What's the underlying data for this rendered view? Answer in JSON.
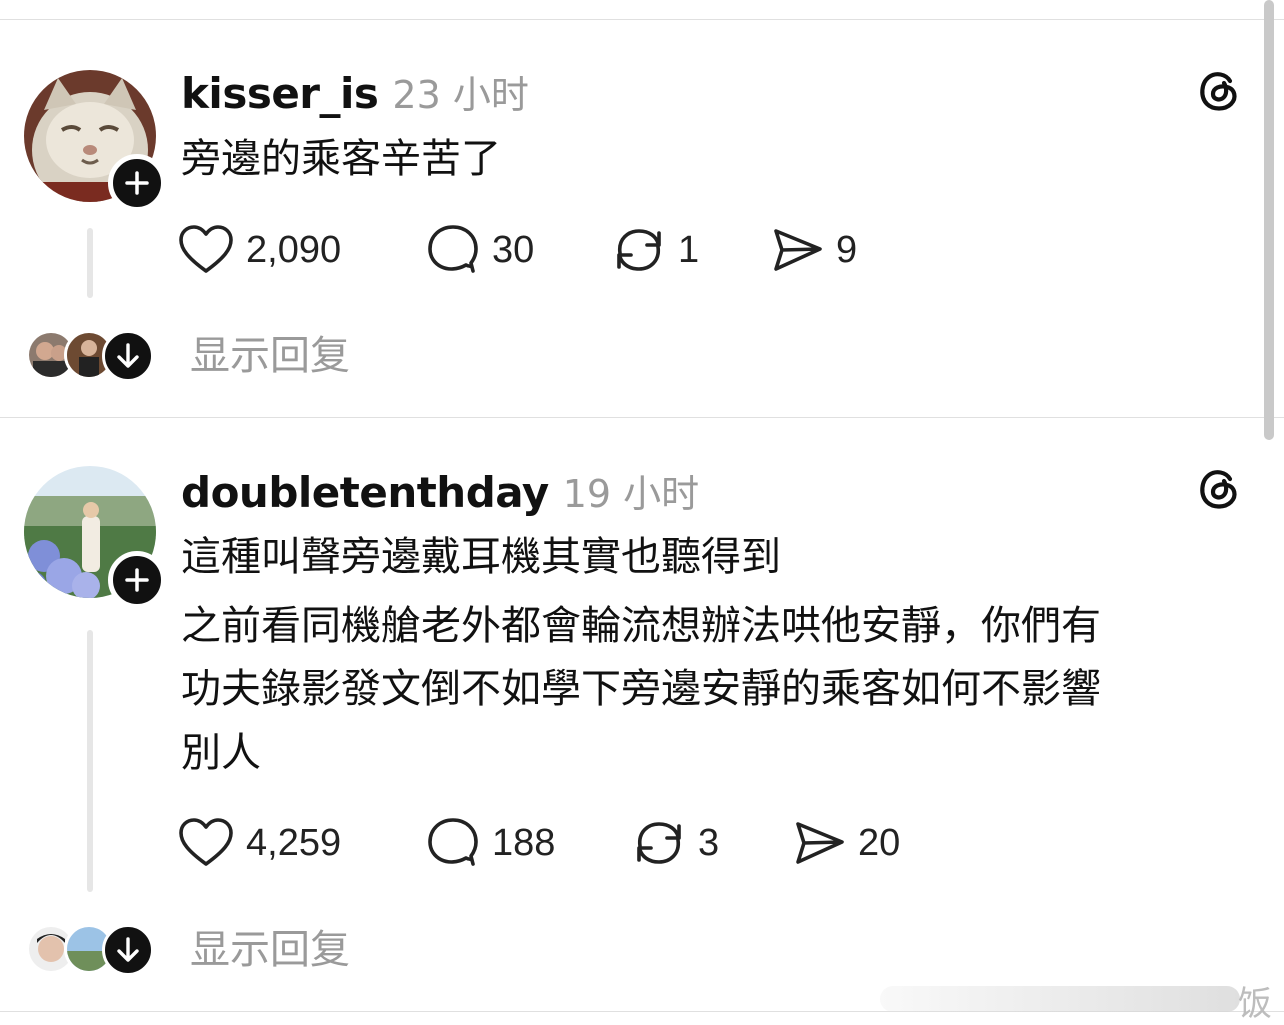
{
  "posts": [
    {
      "username": "kisser_is",
      "time": "23 小时",
      "text_lines": [
        "旁邊的乘客辛苦了"
      ],
      "likes": "2,090",
      "comments": "30",
      "reposts": "1",
      "shares": "9",
      "show_replies": "显示回复",
      "avatar_desc": "white-cat-avatar"
    },
    {
      "username": "doubletenthday",
      "time": "19 小时",
      "text_lines": [
        "這種叫聲旁邊戴耳機其實也聽得到",
        "之前看同機艙老外都會輪流想辦法哄他安靜，你們有",
        "功夫錄影發文倒不如學下旁邊安靜的乘客如何不影響",
        "別人"
      ],
      "likes": "4,259",
      "comments": "188",
      "reposts": "3",
      "shares": "20",
      "show_replies": "显示回复",
      "avatar_desc": "woman-with-hydrangeas-avatar"
    }
  ],
  "watermark": "饭",
  "icons": {
    "like": "heart-icon",
    "comment": "comment-bubble-icon",
    "repost": "repost-icon",
    "share": "send-icon",
    "brand": "threads-logo-icon",
    "follow": "plus-icon",
    "expand": "arrow-down-icon"
  },
  "colors": {
    "text": "#111111",
    "muted": "#9a9a9a",
    "divider": "#e0e0e0",
    "thread_line": "#e6e6e6"
  }
}
